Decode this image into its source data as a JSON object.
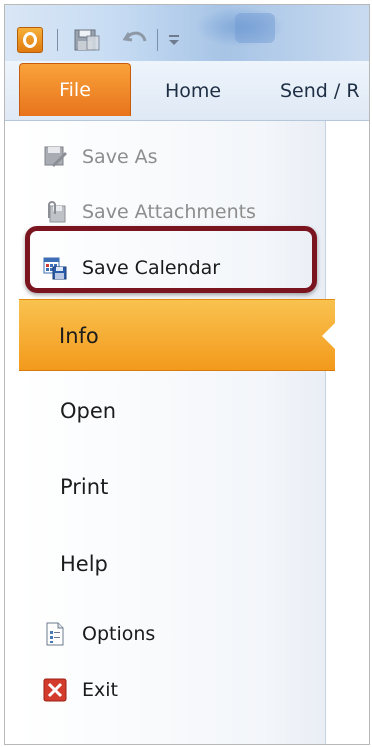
{
  "quick_access": {
    "icons": [
      "outlook-icon",
      "save-icon",
      "undo-icon",
      "customize-dropdown-icon"
    ]
  },
  "ribbon": {
    "file_tab": "File",
    "tabs": [
      "Home",
      "Send / R"
    ]
  },
  "backstage": {
    "commands": [
      {
        "label": "Save As",
        "icon": "save-as-icon",
        "enabled": false
      },
      {
        "label": "Save Attachments",
        "icon": "save-attachments-icon",
        "enabled": false
      },
      {
        "label": "Save Calendar",
        "icon": "save-calendar-icon",
        "enabled": true,
        "highlighted": true
      }
    ],
    "selected": "Info",
    "nav": [
      "Open",
      "Print",
      "Help"
    ],
    "footer_commands": [
      {
        "label": "Options",
        "icon": "options-icon"
      },
      {
        "label": "Exit",
        "icon": "exit-icon"
      }
    ]
  },
  "colors": {
    "file_tab": "#e8741c",
    "selected_item": "#f39a1c",
    "highlight_outline": "#7a1520",
    "exit_icon": "#d33b2c"
  }
}
